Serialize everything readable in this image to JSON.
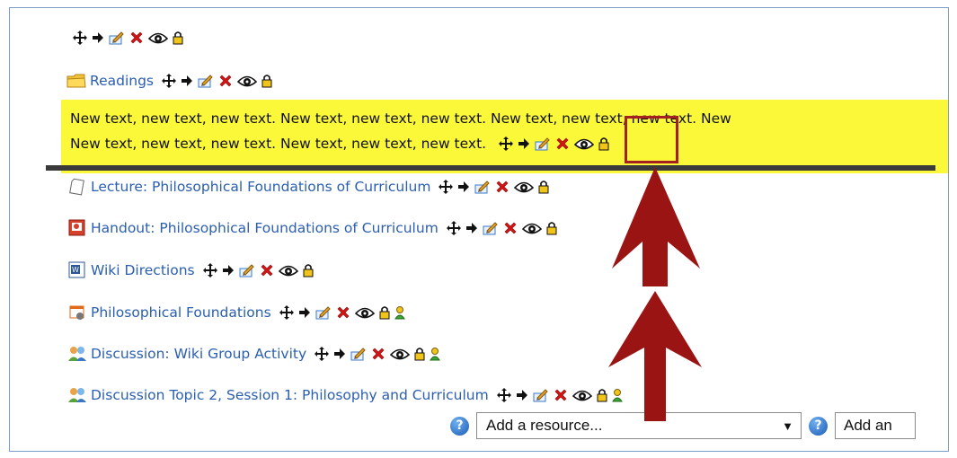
{
  "highlight_lines": [
    "New text, new text, new text. New text, new text, new text. New text, new text, new text. New",
    "New text, new text, new text. New text, new text, new text."
  ],
  "resources": [
    {
      "label": "Readings",
      "icon": "folder-icon",
      "groups": false
    },
    {
      "label": "Lecture: Philosophical Foundations of Curriculum",
      "icon": "file-icon",
      "groups": false
    },
    {
      "label": "Handout: Philosophical Foundations of Curriculum",
      "icon": "powerpoint-icon",
      "groups": false
    },
    {
      "label": "Wiki Directions",
      "icon": "word-icon",
      "groups": false
    },
    {
      "label": "Philosophical Foundations",
      "icon": "wiki-icon",
      "groups": true
    },
    {
      "label": "Discussion: Wiki Group Activity",
      "icon": "forum-icon",
      "groups": true
    },
    {
      "label": "Discussion Topic 2, Session 1: Philosophy and Curriculum",
      "icon": "forum-icon",
      "groups": true
    }
  ],
  "add_resource": {
    "placeholder": "Add a resource...",
    "arrow": "▼"
  },
  "add_activity": {
    "placeholder": "Add an"
  },
  "help_glyph": "?",
  "colors": {
    "highlight": "#fbf83a",
    "link": "#2a5eb0",
    "arrow": "#9b1414",
    "box": "#a52020"
  }
}
